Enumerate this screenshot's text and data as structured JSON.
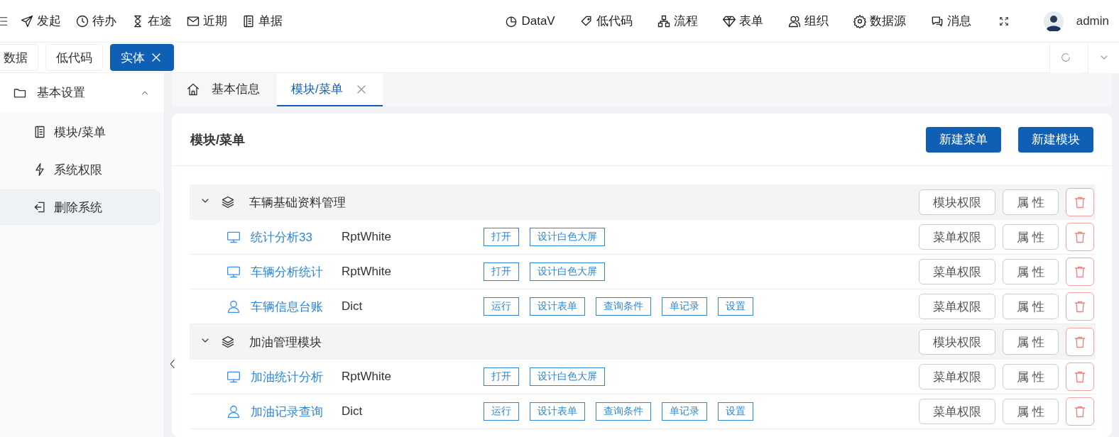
{
  "top_nav": {
    "left_items": [
      {
        "label": "发起"
      },
      {
        "label": "待办"
      },
      {
        "label": "在途"
      },
      {
        "label": "近期"
      },
      {
        "label": "单据"
      }
    ],
    "right_items": [
      {
        "label": "DataV"
      },
      {
        "label": "低代码"
      },
      {
        "label": "流程"
      },
      {
        "label": "表单"
      },
      {
        "label": "组织"
      },
      {
        "label": "数据源"
      },
      {
        "label": "消息"
      }
    ],
    "user": "admin"
  },
  "tag_tabs": [
    {
      "label": "数据",
      "selected": false,
      "closable": false
    },
    {
      "label": "低代码",
      "selected": false,
      "closable": false
    },
    {
      "label": "实体",
      "selected": true,
      "closable": true
    }
  ],
  "sidebar": {
    "items": [
      {
        "label": "基本设置",
        "expanded": true,
        "children": [
          {
            "label": "模块/菜单",
            "selected": false
          },
          {
            "label": "系统权限",
            "selected": false
          },
          {
            "label": "删除系统",
            "selected": true
          }
        ]
      }
    ]
  },
  "page_tabs": [
    {
      "label": "基本信息",
      "selected": false,
      "closable": false
    },
    {
      "label": "模块/菜单",
      "selected": true,
      "closable": true
    }
  ],
  "card": {
    "title": "模块/菜单",
    "buttons": [
      "新建菜单",
      "新建模块"
    ]
  },
  "modules": [
    {
      "name": "车辆基础资料管理",
      "expanded": true,
      "perm_button": "模块权限",
      "attr_button": "属 性",
      "menus": [
        {
          "name": "统计分析33",
          "kind": "report",
          "type": "RptWhite",
          "actions": [
            "打开",
            "设计白色大屏"
          ],
          "perm_button": "菜单权限",
          "attr_button": "属 性"
        },
        {
          "name": "车辆分析统计",
          "kind": "report",
          "type": "RptWhite",
          "actions": [
            "打开",
            "设计白色大屏"
          ],
          "perm_button": "菜单权限",
          "attr_button": "属 性"
        },
        {
          "name": "车辆信息台账",
          "kind": "dict",
          "type": "Dict",
          "actions": [
            "运行",
            "设计表单",
            "查询条件",
            "单记录",
            "设置"
          ],
          "perm_button": "菜单权限",
          "attr_button": "属 性"
        }
      ]
    },
    {
      "name": "加油管理模块",
      "expanded": true,
      "perm_button": "模块权限",
      "attr_button": "属 性",
      "menus": [
        {
          "name": "加油统计分析",
          "kind": "report",
          "type": "RptWhite",
          "actions": [
            "打开",
            "设计白色大屏"
          ],
          "perm_button": "菜单权限",
          "attr_button": "属 性"
        },
        {
          "name": "加油记录查询",
          "kind": "dict",
          "type": "Dict",
          "actions": [
            "运行",
            "设计表单",
            "查询条件",
            "单记录",
            "设置"
          ],
          "perm_button": "菜单权限",
          "attr_button": "属 性"
        }
      ]
    }
  ]
}
